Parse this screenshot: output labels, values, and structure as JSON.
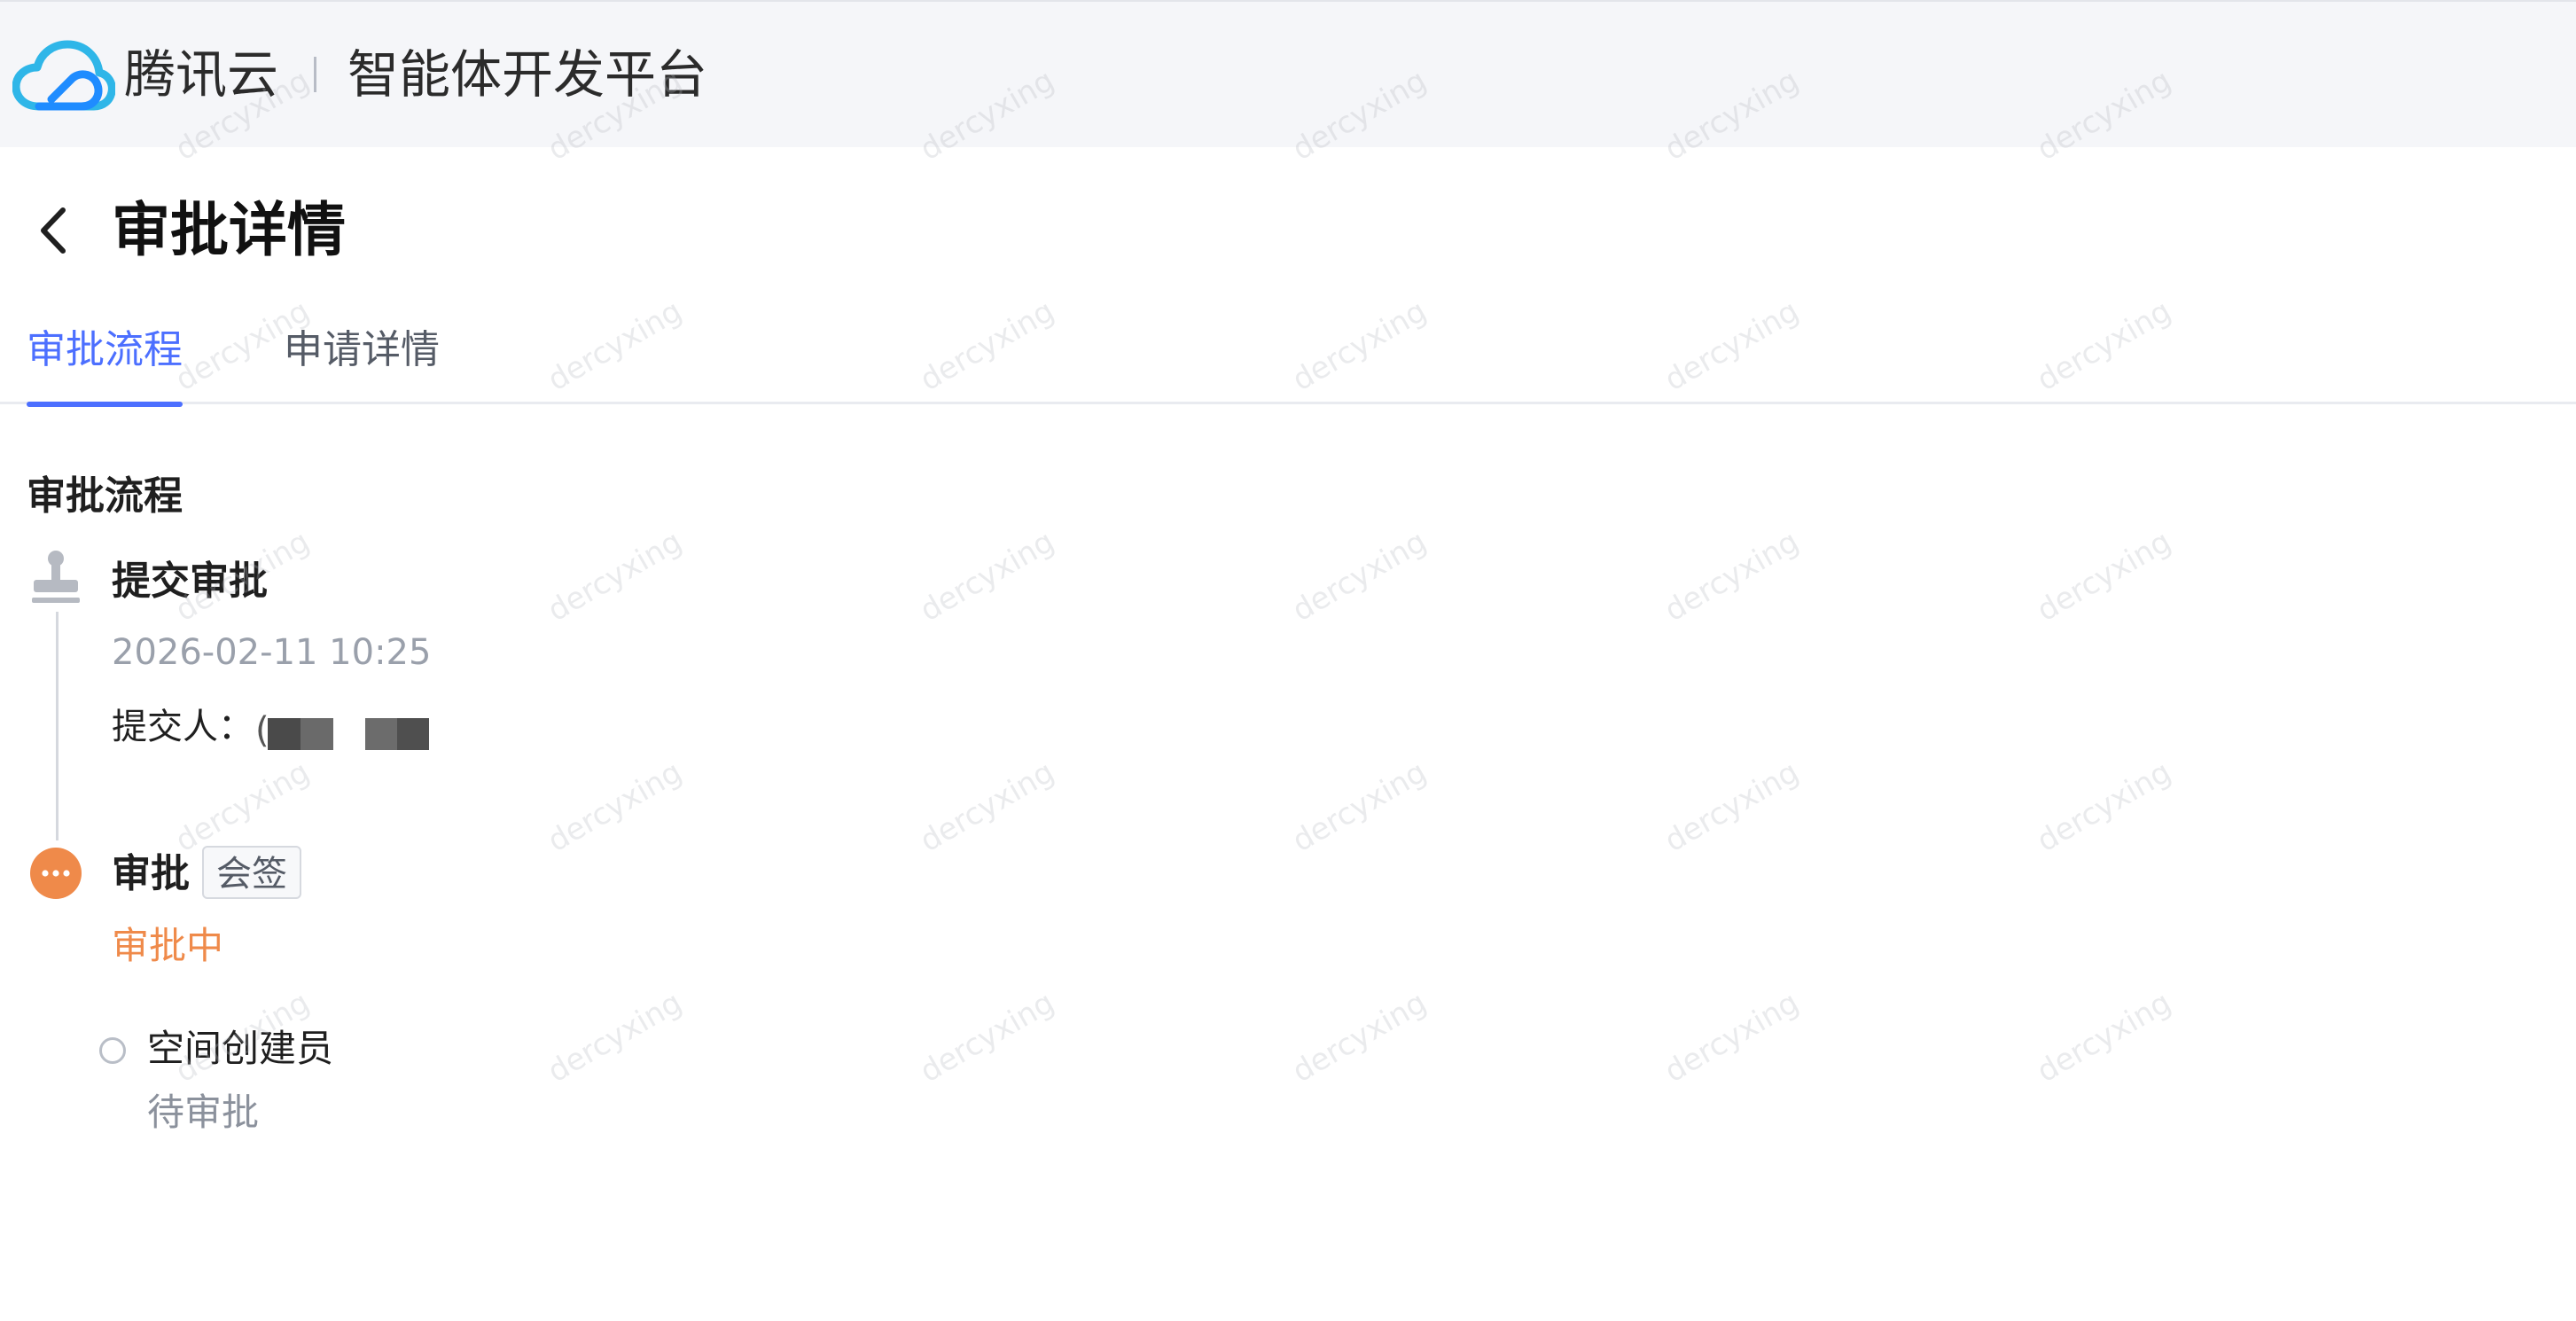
{
  "header": {
    "brand": "腾讯云",
    "product": "智能体开发平台",
    "colors": {
      "brand_blue": "#1f8cff",
      "brand_teal": "#2fb6e8"
    }
  },
  "page": {
    "title": "审批详情",
    "back_icon": "chevron-left-icon"
  },
  "tabs": [
    {
      "label": "审批流程",
      "active": true
    },
    {
      "label": "申请详情",
      "active": false
    }
  ],
  "section": {
    "title": "审批流程"
  },
  "steps": [
    {
      "title": "提交审批",
      "icon": "stamp-icon",
      "time": "2026-02-11 10:25",
      "submitter_label": "提交人：",
      "submitter_value_redacted": true,
      "redacted_prefix": "("
    },
    {
      "title": "审批",
      "tag": "会签",
      "icon": "more-dots-icon",
      "status": "审批中",
      "status_color": "#ef8a4a",
      "approvers": [
        {
          "name": "空间创建员",
          "status": "待审批"
        }
      ]
    }
  ],
  "watermark": "dercyxing",
  "colors": {
    "accent": "#4c6fff",
    "pending_orange": "#ef8a4a",
    "muted_text": "#9aa0ab"
  }
}
